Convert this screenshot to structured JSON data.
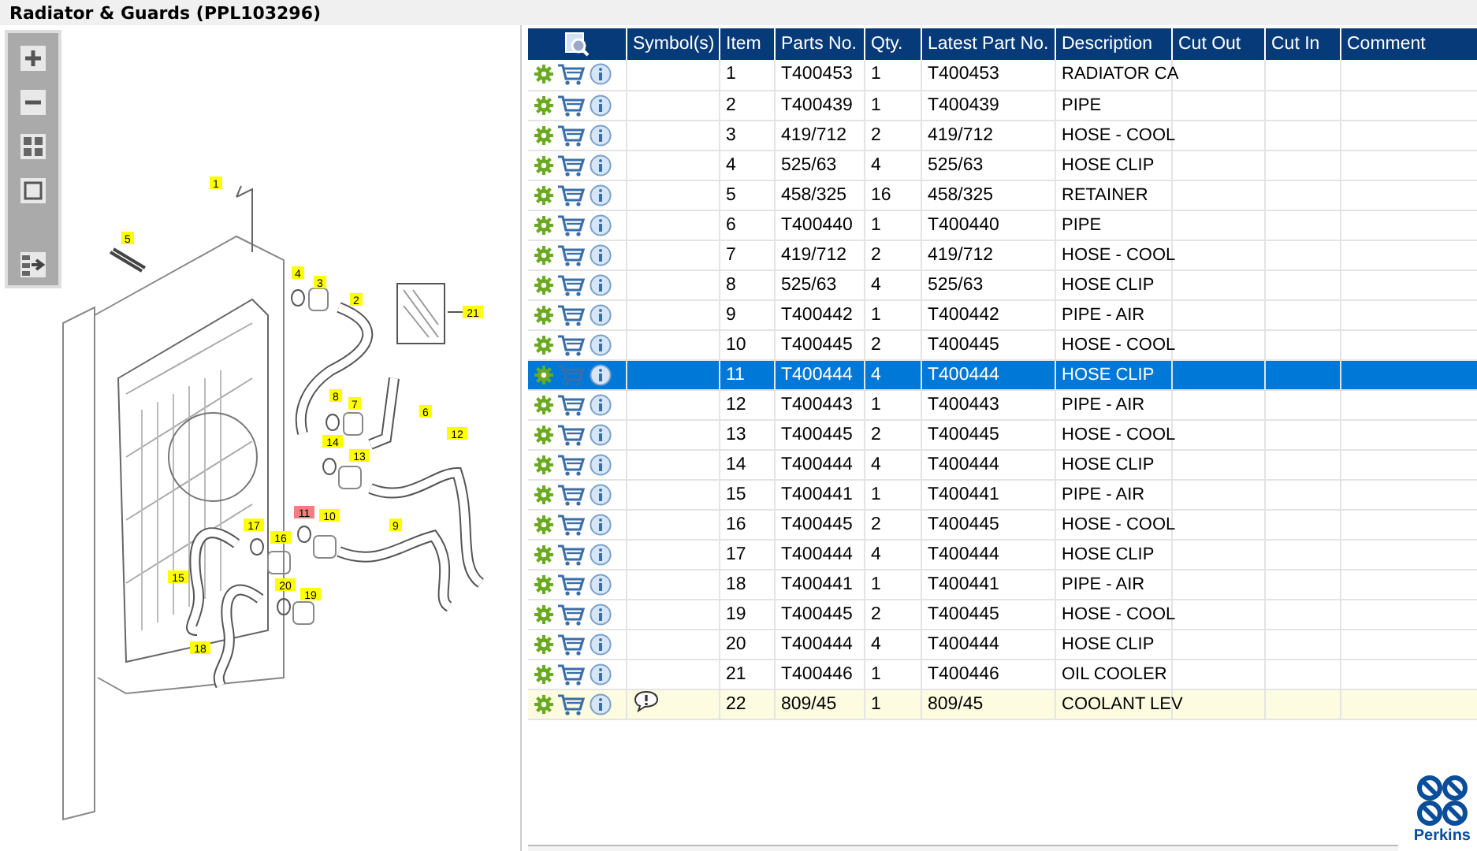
{
  "title": "Radiator & Guards (PPL103296)",
  "toolbar": [
    {
      "kind": "zoom-in"
    },
    {
      "kind": "zoom-out"
    },
    {
      "kind": "fit"
    },
    {
      "kind": "frame"
    },
    {
      "kind": "panel"
    }
  ],
  "diagram": {
    "callouts": [
      {
        "label": "1",
        "selected": false
      },
      {
        "label": "5",
        "selected": false
      },
      {
        "label": "4",
        "selected": false
      },
      {
        "label": "3",
        "selected": false
      },
      {
        "label": "2",
        "selected": false
      },
      {
        "label": "21",
        "selected": false
      },
      {
        "label": "8",
        "selected": false
      },
      {
        "label": "7",
        "selected": false
      },
      {
        "label": "6",
        "selected": false
      },
      {
        "label": "14",
        "selected": false
      },
      {
        "label": "13",
        "selected": false
      },
      {
        "label": "12",
        "selected": false
      },
      {
        "label": "11",
        "selected": true
      },
      {
        "label": "10",
        "selected": false
      },
      {
        "label": "9",
        "selected": false
      },
      {
        "label": "17",
        "selected": false
      },
      {
        "label": "16",
        "selected": false
      },
      {
        "label": "15",
        "selected": false
      },
      {
        "label": "20",
        "selected": false
      },
      {
        "label": "19",
        "selected": false
      },
      {
        "label": "18",
        "selected": false
      }
    ]
  },
  "table": {
    "columns": [
      "Symbol(s)",
      "Item",
      "Parts No.",
      "Qty.",
      "Latest Part No.",
      "Description",
      "Cut Out",
      "Cut In",
      "Comment"
    ],
    "rows": [
      {
        "item": "1",
        "part": "T400453",
        "qty": "1",
        "latest": "T400453",
        "description": "RADIATOR CA",
        "selected": false,
        "flagged": false
      },
      {
        "item": "2",
        "part": "T400439",
        "qty": "1",
        "latest": "T400439",
        "description": "PIPE",
        "selected": false,
        "flagged": false
      },
      {
        "item": "3",
        "part": "419/712",
        "qty": "2",
        "latest": "419/712",
        "description": "HOSE - COOL",
        "selected": false,
        "flagged": false
      },
      {
        "item": "4",
        "part": "525/63",
        "qty": "4",
        "latest": "525/63",
        "description": "HOSE CLIP",
        "selected": false,
        "flagged": false
      },
      {
        "item": "5",
        "part": "458/325",
        "qty": "16",
        "latest": "458/325",
        "description": "RETAINER",
        "selected": false,
        "flagged": false
      },
      {
        "item": "6",
        "part": "T400440",
        "qty": "1",
        "latest": "T400440",
        "description": "PIPE",
        "selected": false,
        "flagged": false
      },
      {
        "item": "7",
        "part": "419/712",
        "qty": "2",
        "latest": "419/712",
        "description": "HOSE - COOL",
        "selected": false,
        "flagged": false
      },
      {
        "item": "8",
        "part": "525/63",
        "qty": "4",
        "latest": "525/63",
        "description": "HOSE CLIP",
        "selected": false,
        "flagged": false
      },
      {
        "item": "9",
        "part": "T400442",
        "qty": "1",
        "latest": "T400442",
        "description": "PIPE - AIR",
        "selected": false,
        "flagged": false
      },
      {
        "item": "10",
        "part": "T400445",
        "qty": "2",
        "latest": "T400445",
        "description": "HOSE - COOL",
        "selected": false,
        "flagged": false
      },
      {
        "item": "11",
        "part": "T400444",
        "qty": "4",
        "latest": "T400444",
        "description": "HOSE CLIP",
        "selected": true,
        "flagged": false
      },
      {
        "item": "12",
        "part": "T400443",
        "qty": "1",
        "latest": "T400443",
        "description": "PIPE - AIR",
        "selected": false,
        "flagged": false
      },
      {
        "item": "13",
        "part": "T400445",
        "qty": "2",
        "latest": "T400445",
        "description": "HOSE - COOL",
        "selected": false,
        "flagged": false
      },
      {
        "item": "14",
        "part": "T400444",
        "qty": "4",
        "latest": "T400444",
        "description": "HOSE CLIP",
        "selected": false,
        "flagged": false
      },
      {
        "item": "15",
        "part": "T400441",
        "qty": "1",
        "latest": "T400441",
        "description": "PIPE - AIR",
        "selected": false,
        "flagged": false
      },
      {
        "item": "16",
        "part": "T400445",
        "qty": "2",
        "latest": "T400445",
        "description": "HOSE - COOL",
        "selected": false,
        "flagged": false
      },
      {
        "item": "17",
        "part": "T400444",
        "qty": "4",
        "latest": "T400444",
        "description": "HOSE CLIP",
        "selected": false,
        "flagged": false
      },
      {
        "item": "18",
        "part": "T400441",
        "qty": "1",
        "latest": "T400441",
        "description": "PIPE - AIR",
        "selected": false,
        "flagged": false
      },
      {
        "item": "19",
        "part": "T400445",
        "qty": "2",
        "latest": "T400445",
        "description": "HOSE - COOL",
        "selected": false,
        "flagged": false
      },
      {
        "item": "20",
        "part": "T400444",
        "qty": "4",
        "latest": "T400444",
        "description": "HOSE CLIP",
        "selected": false,
        "flagged": false
      },
      {
        "item": "21",
        "part": "T400446",
        "qty": "1",
        "latest": "T400446",
        "description": "OIL COOLER",
        "selected": false,
        "flagged": false
      },
      {
        "item": "22",
        "part": "809/45",
        "qty": "1",
        "latest": "809/45",
        "description": "COOLANT LEV",
        "selected": false,
        "flagged": true
      }
    ]
  },
  "logo": {
    "text": "Perkins"
  }
}
